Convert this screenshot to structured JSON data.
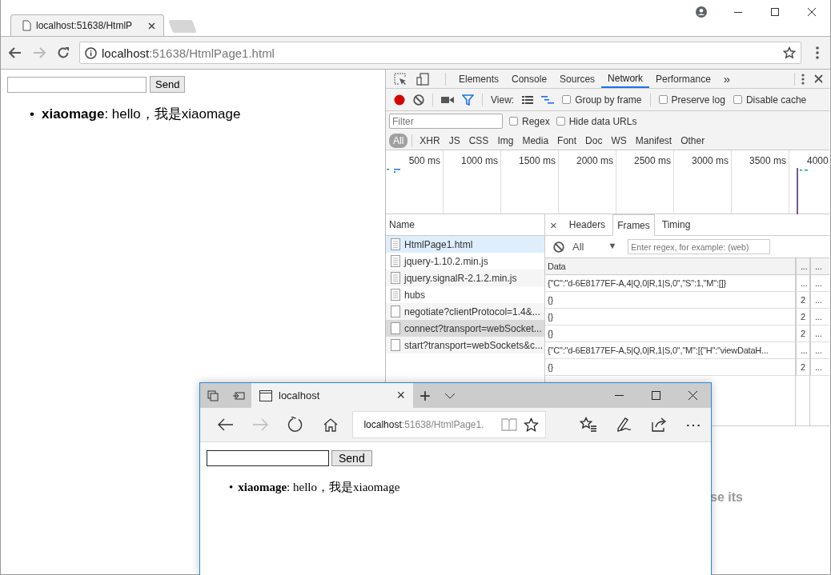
{
  "chrome": {
    "tab_title": "localhost:51638/HtmlP",
    "url_host": "localhost",
    "url_rest": ":51638/HtmlPage1.html"
  },
  "page": {
    "send_label": "Send",
    "messages": [
      {
        "bullet": "•",
        "text": "**xiaomage**:  hello，我是xiaomage"
      }
    ]
  },
  "devtools": {
    "tabs": [
      {
        "label": "Elements",
        "selected": false
      },
      {
        "label": "Console",
        "selected": false
      },
      {
        "label": "Sources",
        "selected": false
      },
      {
        "label": "Network",
        "selected": true
      },
      {
        "label": "Performance",
        "selected": false
      }
    ],
    "more_tabs": "»",
    "view_label": "View:",
    "toolbar_checkboxes": [
      {
        "label": "Group by frame",
        "checked": false
      },
      {
        "label": "Preserve log",
        "checked": false
      },
      {
        "label": "Disable cache",
        "checked": false
      }
    ],
    "filter": {
      "placeholder": "Filter"
    },
    "filter_checkboxes": [
      {
        "label": "Regex",
        "checked": false
      },
      {
        "label": "Hide data URLs",
        "checked": false
      }
    ],
    "types": [
      {
        "label": "All",
        "selected": true
      },
      {
        "label": "XHR",
        "selected": false
      },
      {
        "label": "JS",
        "selected": false
      },
      {
        "label": "CSS",
        "selected": false
      },
      {
        "label": "Img",
        "selected": false
      },
      {
        "label": "Media",
        "selected": false
      },
      {
        "label": "Font",
        "selected": false
      },
      {
        "label": "Doc",
        "selected": false
      },
      {
        "label": "WS",
        "selected": false
      },
      {
        "label": "Manifest",
        "selected": false
      },
      {
        "label": "Other",
        "selected": false
      }
    ],
    "timeline_ticks": [
      "500 ms",
      "1000 ms",
      "1500 ms",
      "2000 ms",
      "2500 ms",
      "3000 ms",
      "3500 ms",
      "4000"
    ],
    "name_header": "Name",
    "requests": [
      {
        "name": "HtmlPage1.html",
        "kind": "document",
        "selected": false,
        "hovered": true
      },
      {
        "name": "jquery-1.10.2.min.js",
        "kind": "document",
        "selected": false,
        "hovered": false
      },
      {
        "name": "jquery.signalR-2.1.2.min.js",
        "kind": "document",
        "selected": false,
        "hovered": false
      },
      {
        "name": "hubs",
        "kind": "document",
        "selected": false,
        "hovered": false
      },
      {
        "name": "negotiate?clientProtocol=1.4&...",
        "kind": "blank",
        "selected": false,
        "hovered": false
      },
      {
        "name": "connect?transport=webSocket...",
        "kind": "blank",
        "selected": true,
        "hovered": false
      },
      {
        "name": "start?transport=webSockets&c...",
        "kind": "blank",
        "selected": false,
        "hovered": false
      }
    ],
    "detail_close": "×",
    "detail_tabs": [
      {
        "label": "Headers",
        "selected": false
      },
      {
        "label": "Frames",
        "selected": true
      },
      {
        "label": "Timing",
        "selected": false
      }
    ],
    "frames_filter": {
      "option": "All",
      "arrow": "▼",
      "placeholder": "Enter regex, for example: (web)"
    },
    "frame_columns": [
      "Data",
      "...",
      "..."
    ],
    "frames": [
      {
        "data": "{\"C\":\"d-6E8177EF-A,4|Q,0|R,1|S,0\",\"S\":1,\"M\":[]}",
        "column_2": "...",
        "column_3": "..."
      },
      {
        "data": "{}",
        "column_2": "2",
        "column_3": "..."
      },
      {
        "data": "{}",
        "column_2": "2",
        "column_3": "..."
      },
      {
        "data": "{}",
        "column_2": "2",
        "column_3": "..."
      },
      {
        "data": "{\"C\":\"d-6E8177EF-A,5|Q,0|R,1|S,0\",\"M\":[{\"H\":\"viewDataH...",
        "column_2": "...",
        "column_3": "..."
      },
      {
        "data": "{}",
        "column_2": "2",
        "column_3": "..."
      }
    ],
    "bottom_text": "se its"
  },
  "edge": {
    "tab_title": "localhost",
    "tab_close": "×",
    "new_tab": "+",
    "url_host": "localhost",
    "url_rest": ":51638/HtmlPage1.",
    "more": "⋯",
    "send_label": "Send",
    "messages": [
      {
        "bullet": "•",
        "text": "**xiaomage**:  hello，我是xiaomage"
      }
    ]
  }
}
